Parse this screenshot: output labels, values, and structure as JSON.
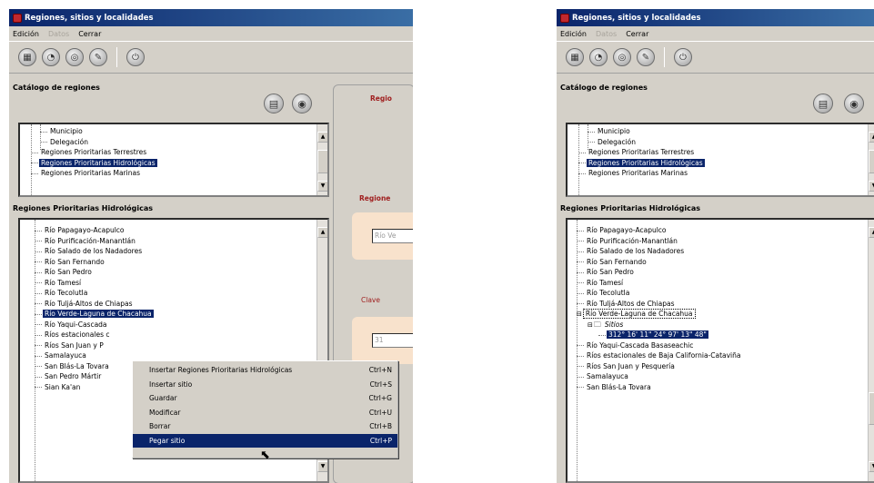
{
  "window": {
    "title": "Regiones, sitios y localidades"
  },
  "menu": [
    {
      "label": "Edición",
      "enabled": true
    },
    {
      "label": "Datos",
      "enabled": false
    },
    {
      "label": "Cerrar",
      "enabled": true
    }
  ],
  "toolbar_icons": [
    "new-icon",
    "open-icon",
    "refresh-icon",
    "tools-icon",
    "exit-icon"
  ],
  "catalog": {
    "label": "Catálogo de regiones",
    "items": [
      {
        "label": "Municipio",
        "level": 2,
        "selected": false
      },
      {
        "label": "Delegación",
        "level": 2,
        "selected": false
      },
      {
        "label": "Regiones Prioritarias Terrestres",
        "level": 1,
        "selected": false
      },
      {
        "label": "Regiones Prioritarias Hidrológicas",
        "level": 1,
        "selected": true
      },
      {
        "label": "Regiones Prioritarias Marinas",
        "level": 1,
        "selected": false
      }
    ]
  },
  "hydro": {
    "label": "Regiones Prioritarias Hidrológicas",
    "items_left": [
      {
        "label": "Río Papagayo-Acapulco"
      },
      {
        "label": "Río Purificación-Manantlán"
      },
      {
        "label": "Río Salado de los Nadadores"
      },
      {
        "label": "Río San Fernando"
      },
      {
        "label": "Río San Pedro"
      },
      {
        "label": "Río Tamesí"
      },
      {
        "label": "Río Tecolutla"
      },
      {
        "label": "Río Tuljá-Altos de Chiapas"
      },
      {
        "label": "Río Verde-Laguna de Chacahua",
        "selected": true
      },
      {
        "label": "Río Yaqui-Cascada"
      },
      {
        "label": "Ríos estacionales c"
      },
      {
        "label": "Ríos San Juan y P"
      },
      {
        "label": "Samalayuca"
      },
      {
        "label": "San Blás-La Tovara"
      },
      {
        "label": "San Pedro Mártir"
      },
      {
        "label": "Sian Ka'an"
      }
    ],
    "items_right": [
      {
        "label": "Río Papagayo-Acapulco",
        "depth": 1
      },
      {
        "label": "Río Purificación-Manantlán",
        "depth": 1
      },
      {
        "label": "Río Salado de los Nadadores",
        "depth": 1
      },
      {
        "label": "Río San Fernando",
        "depth": 1
      },
      {
        "label": "Río San Pedro",
        "depth": 1
      },
      {
        "label": "Río Tamesí",
        "depth": 1
      },
      {
        "label": "Río Tecolutla",
        "depth": 1
      },
      {
        "label": "Río Tuljá-Altos de Chiapas",
        "depth": 1
      },
      {
        "label": "Río Verde-Laguna de Chacahua",
        "depth": 1,
        "boxed": true,
        "expander": "−"
      },
      {
        "label": "Sitios",
        "depth": 2,
        "folder": true,
        "expander": "−",
        "italic": true
      },
      {
        "label": "312° 16' 11\" 24° 97' 13\" 48\"",
        "depth": 3,
        "selected": true
      },
      {
        "label": "Río Yaqui-Cascada Basaseachic",
        "depth": 1
      },
      {
        "label": "Ríos estacionales de Baja California-Cataviña",
        "depth": 1
      },
      {
        "label": "Ríos San Juan y Pesquería",
        "depth": 1
      },
      {
        "label": "Samalayuca",
        "depth": 1
      },
      {
        "label": "San Blás-La Tovara",
        "depth": 1
      }
    ]
  },
  "detail_panel": {
    "header": "Regio",
    "region_label": "Regione",
    "region_value": "Río Ve",
    "clave_label": "Clave",
    "clave_value": "31"
  },
  "context_menu": [
    {
      "label": "Insertar Regiones Prioritarias Hidrológicas",
      "shortcut": "Ctrl+N"
    },
    {
      "label": "Insertar sitio",
      "shortcut": "Ctrl+S"
    },
    {
      "label": "Guardar",
      "shortcut": "Ctrl+G"
    },
    {
      "label": "Modificar",
      "shortcut": "Ctrl+U"
    },
    {
      "label": "Borrar",
      "shortcut": "Ctrl+B"
    },
    {
      "label": "Pegar sitio",
      "shortcut": "Ctrl+P",
      "hover": true
    }
  ]
}
